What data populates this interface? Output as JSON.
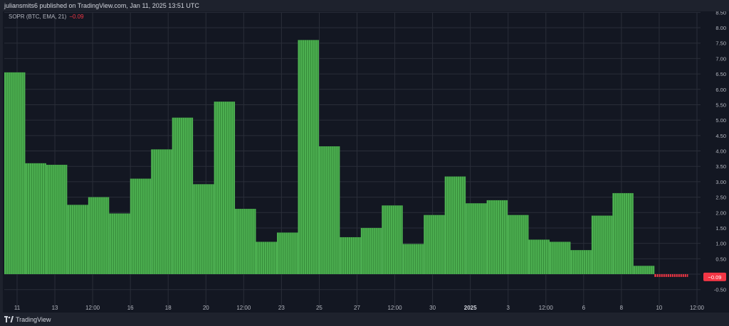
{
  "header": {
    "published_text": "juliansmits6 published on TradingView.com, Jan 11, 2025 13:51 UTC"
  },
  "legend": {
    "label": "SOPR (BTC, EMA, 21)",
    "value": "−0.09"
  },
  "footer": {
    "brand": "TradingView"
  },
  "colors": {
    "background": "#131722",
    "positive": "#4caf50",
    "negative": "#f23645",
    "grid": "#2a2e39",
    "axis_text": "#b2b5be"
  },
  "chart_data": {
    "type": "bar",
    "title": "SOPR (BTC, EMA, 21)",
    "last_value_label": "−0.09",
    "y_ticks": [
      "-0.50",
      "0.00",
      "0.50",
      "1.00",
      "1.50",
      "2.00",
      "2.50",
      "3.00",
      "3.50",
      "4.00",
      "4.50",
      "5.00",
      "5.50",
      "6.00",
      "6.50",
      "7.00",
      "7.50",
      "8.00",
      "8.50"
    ],
    "ylim": [
      -0.5,
      8.5
    ],
    "x_ticks": [
      "11",
      "13",
      "12:00",
      "16",
      "18",
      "20",
      "12:00",
      "23",
      "25",
      "27",
      "12:00",
      "30",
      "2025",
      "3",
      "12:00",
      "6",
      "8",
      "10",
      "12:00"
    ],
    "grid": true,
    "series": [
      {
        "values": [
          6.55,
          3.6,
          3.55,
          2.25,
          2.5,
          1.97,
          3.1,
          4.05,
          5.08,
          2.92,
          5.6,
          2.12,
          1.05,
          1.35,
          7.6,
          4.15,
          1.2,
          1.5,
          2.23,
          0.98,
          1.92,
          3.17,
          2.3,
          2.4,
          1.92,
          1.12,
          1.05,
          0.78,
          1.9,
          2.63,
          0.27,
          -0.09
        ]
      }
    ]
  }
}
